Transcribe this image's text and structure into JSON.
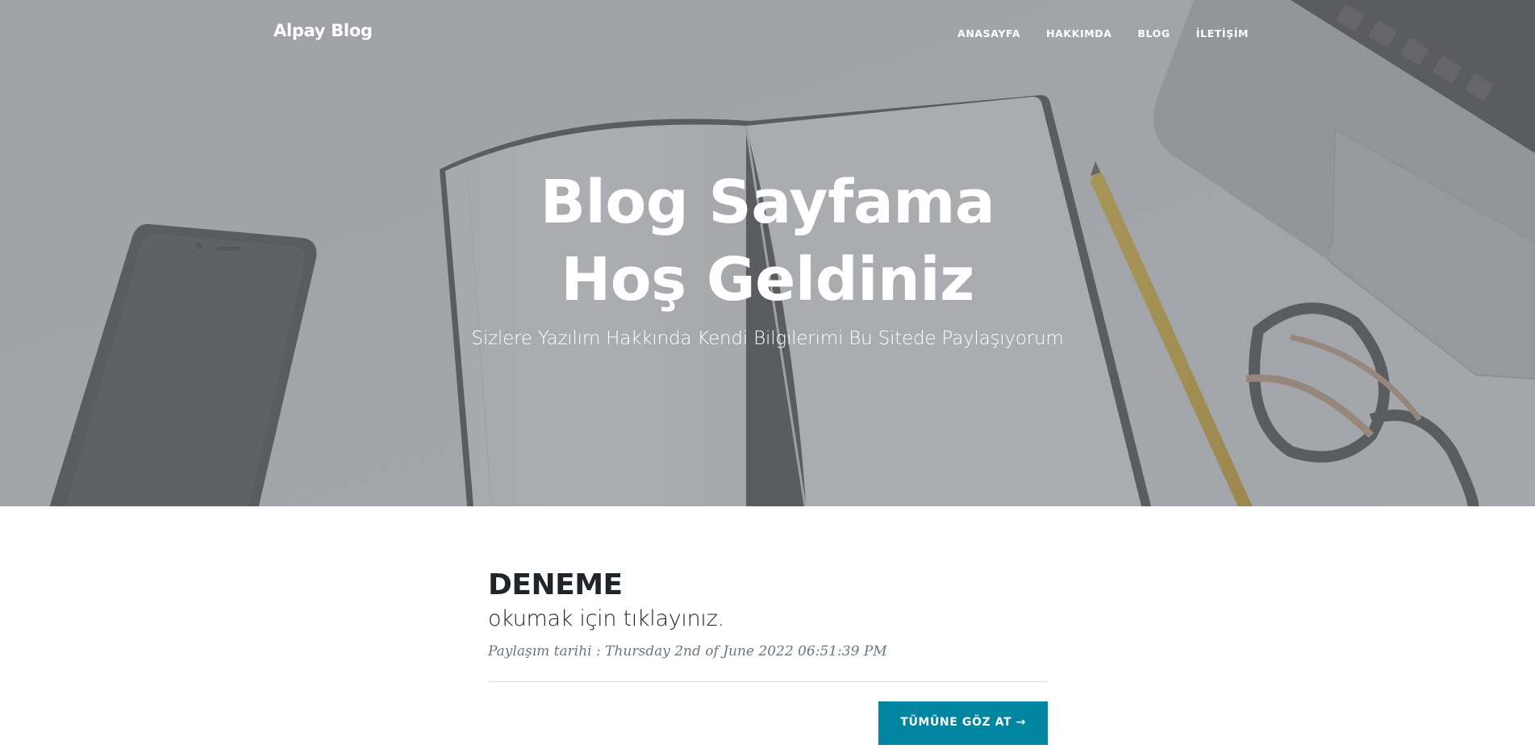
{
  "nav": {
    "brand": "Alpay Blog",
    "items": [
      {
        "label": "ANASAYFA"
      },
      {
        "label": "HAKKIMDA"
      },
      {
        "label": "BLOG"
      },
      {
        "label": "İLETİŞİM"
      }
    ]
  },
  "hero": {
    "title_line1": "Blog Sayfama",
    "title_line2": "Hoş Geldiniz",
    "subtitle": "Sizlere Yazılım Hakkında Kendi Bilgilerimi Bu Sitede Paylaşıyorum"
  },
  "posts": [
    {
      "title": "DENEME",
      "subtitle": "okumak için tıklayınız.",
      "meta": "Paylaşım tarihi : Thursday 2nd of June 2022 06:51:39 PM"
    }
  ],
  "pager": {
    "all_button": "TÜMÜNE GÖZ AT →"
  },
  "colors": {
    "accent": "#0085a1",
    "text_dark": "#212529",
    "meta_gray": "#6c757d",
    "hero_overlay": "#787a80"
  }
}
